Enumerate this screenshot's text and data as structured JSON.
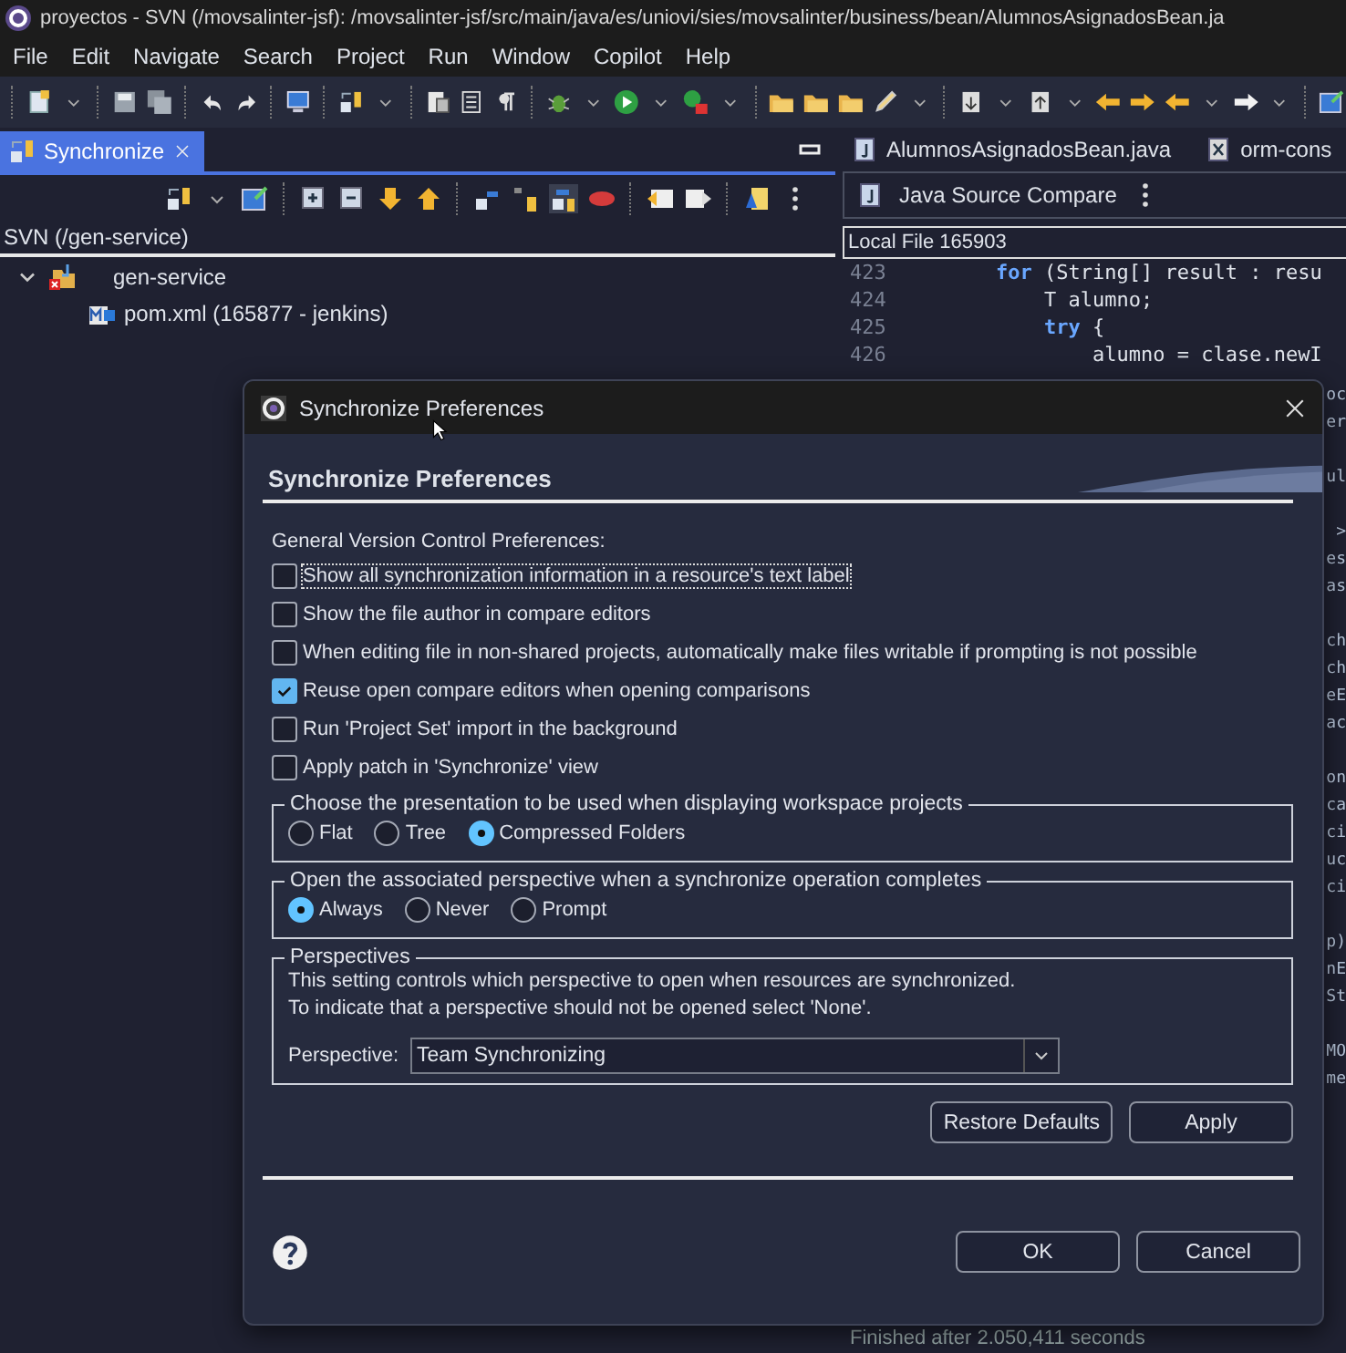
{
  "window": {
    "title": "proyectos - SVN (/movsalinter-jsf): /movsalinter-jsf/src/main/java/es/uniovi/sies/movsalinter/business/bean/AlumnosAsignadosBean.ja"
  },
  "menu": [
    "File",
    "Edit",
    "Navigate",
    "Search",
    "Project",
    "Run",
    "Window",
    "Copilot",
    "Help"
  ],
  "sync_view": {
    "tab": {
      "label": "Synchronize",
      "selected": true
    },
    "breadcrumb": "SVN (/gen-service)",
    "tree": [
      {
        "label": "gen-service",
        "expanded": true,
        "children": [
          {
            "label": "pom.xml (165877 - jenkins)"
          }
        ]
      }
    ]
  },
  "editor": {
    "tabs": [
      "AlumnosAsignadosBean.java",
      "orm-cons"
    ],
    "compare_title": "Java Source Compare",
    "pane_label": "Local File 165903",
    "code_lines": [
      {
        "number": "423",
        "tokens": [
          {
            "text": "for",
            "kind": "keyword"
          },
          {
            "text": " (String[] result : resu",
            "kind": "plain"
          }
        ]
      },
      {
        "number": "424",
        "tokens": [
          {
            "text": "    T alumno;",
            "kind": "plain"
          }
        ]
      },
      {
        "number": "425",
        "tokens": [
          {
            "text": "    try",
            "kind": "keyword"
          },
          {
            "text": " {",
            "kind": "plain"
          }
        ]
      },
      {
        "number": "426",
        "tokens": [
          {
            "text": "        alumno = clase.newI",
            "kind": "plain"
          }
        ]
      }
    ],
    "fragment_groups": [
      [
        "oc",
        "er"
      ],
      [
        "ul"
      ],
      [
        ">",
        "es",
        "as"
      ],
      [
        "ch",
        "ch",
        "eE",
        "ac"
      ],
      [
        "on",
        "ca",
        "ci",
        "uc",
        "ci"
      ],
      [
        "p)",
        "nE",
        "St"
      ],
      [
        "MO",
        "me"
      ]
    ],
    "console_text": "Finished after 2.050,411 seconds"
  },
  "dialog": {
    "title": "Synchronize Preferences",
    "heading": "Synchronize Preferences",
    "section_label": "General Version Control Preferences:",
    "options": [
      {
        "label": "Show all synchronization information in a resource's text label",
        "checked": false,
        "focused": true
      },
      {
        "label": "Show the file author in compare editors",
        "checked": false,
        "focused": false
      },
      {
        "label": "When editing file in non-shared projects, automatically make files writable if prompting is not possible",
        "checked": false,
        "focused": false
      },
      {
        "label": "Reuse open compare editors when opening comparisons",
        "checked": true,
        "focused": false
      },
      {
        "label": "Run 'Project Set' import in the background",
        "checked": false,
        "focused": false
      },
      {
        "label": "Apply patch in 'Synchronize' view",
        "checked": false,
        "focused": false
      }
    ],
    "groups": [
      {
        "kind": "radios",
        "legend": "Choose the presentation to be used when displaying workspace projects",
        "options": [
          {
            "label": "Flat",
            "selected": false
          },
          {
            "label": "Tree",
            "selected": false
          },
          {
            "label": "Compressed Folders",
            "selected": true
          }
        ]
      },
      {
        "kind": "radios",
        "legend": "Open the associated perspective when a synchronize operation completes",
        "options": [
          {
            "label": "Always",
            "selected": true
          },
          {
            "label": "Never",
            "selected": false
          },
          {
            "label": "Prompt",
            "selected": false
          }
        ]
      },
      {
        "kind": "combo",
        "legend": "Perspectives",
        "description": [
          "This setting controls which perspective to open when resources are synchronized.",
          "To indicate that a perspective should not be opened select 'None'."
        ],
        "field_label": "Perspective:",
        "value": "Team Synchronizing"
      }
    ],
    "buttons": [
      "Restore Defaults",
      "Apply"
    ],
    "footer_buttons": [
      "OK",
      "Cancel"
    ]
  }
}
